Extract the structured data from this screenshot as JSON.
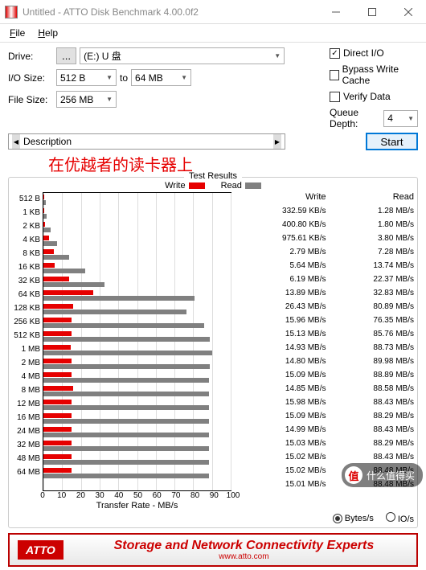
{
  "window": {
    "title": "Untitled - ATTO Disk Benchmark 4.00.0f2"
  },
  "menu": {
    "file": "File",
    "help": "Help"
  },
  "labels": {
    "drive": "Drive:",
    "iosize": "I/O Size:",
    "filesize": "File Size:",
    "to": "to",
    "directio": "Direct I/O",
    "bypass": "Bypass Write Cache",
    "verify": "Verify Data",
    "queue": "Queue Depth:",
    "desc": "Description",
    "start": "Start",
    "results": "Test Results",
    "write": "Write",
    "read": "Read",
    "xlabel": "Transfer Rate - MB/s",
    "bytes": "Bytes/s",
    "ios": "IO/s"
  },
  "values": {
    "drive_btn": "...",
    "drive": "(E:) U 盘",
    "iosize_from": "512 B",
    "iosize_to": "64 MB",
    "filesize": "256 MB",
    "queue": "4",
    "directio_checked": "✓"
  },
  "annotation": "在优越者的读卡器上",
  "footer": {
    "logo": "ATTO",
    "tagline": "Storage and Network Connectivity Experts",
    "url": "www.atto.com"
  },
  "watermark": "什么值得买",
  "chart_data": {
    "type": "bar",
    "title": "Test Results",
    "xlabel": "Transfer Rate - MB/s",
    "ylabel": "",
    "xlim": [
      0,
      100
    ],
    "x_ticks": [
      0,
      10,
      20,
      30,
      40,
      50,
      60,
      70,
      80,
      90,
      100
    ],
    "categories": [
      "512 B",
      "1 KB",
      "2 KB",
      "4 KB",
      "8 KB",
      "16 KB",
      "32 KB",
      "64 KB",
      "128 KB",
      "256 KB",
      "512 KB",
      "1 MB",
      "2 MB",
      "4 MB",
      "8 MB",
      "12 MB",
      "16 MB",
      "24 MB",
      "32 MB",
      "48 MB",
      "64 MB"
    ],
    "series": [
      {
        "name": "Write",
        "color": "#e60000",
        "values_display": [
          "332.59 KB/s",
          "400.80 KB/s",
          "975.61 KB/s",
          "2.79 MB/s",
          "5.64 MB/s",
          "6.19 MB/s",
          "13.89 MB/s",
          "26.43 MB/s",
          "15.96 MB/s",
          "15.13 MB/s",
          "14.93 MB/s",
          "14.80 MB/s",
          "15.09 MB/s",
          "14.85 MB/s",
          "15.98 MB/s",
          "15.09 MB/s",
          "14.99 MB/s",
          "15.03 MB/s",
          "15.02 MB/s",
          "15.02 MB/s",
          "15.01 MB/s"
        ],
        "values_mb": [
          0.33,
          0.4,
          0.98,
          2.79,
          5.64,
          6.19,
          13.89,
          26.43,
          15.96,
          15.13,
          14.93,
          14.8,
          15.09,
          14.85,
          15.98,
          15.09,
          14.99,
          15.03,
          15.02,
          15.02,
          15.01
        ]
      },
      {
        "name": "Read",
        "color": "#808080",
        "values_display": [
          "1.28 MB/s",
          "1.80 MB/s",
          "3.80 MB/s",
          "7.28 MB/s",
          "13.74 MB/s",
          "22.37 MB/s",
          "32.83 MB/s",
          "80.89 MB/s",
          "76.35 MB/s",
          "85.76 MB/s",
          "88.73 MB/s",
          "89.98 MB/s",
          "88.89 MB/s",
          "88.58 MB/s",
          "88.43 MB/s",
          "88.29 MB/s",
          "88.43 MB/s",
          "88.29 MB/s",
          "88.43 MB/s",
          "88.48 MB/s",
          "88.48 MB/s"
        ],
        "values_mb": [
          1.28,
          1.8,
          3.8,
          7.28,
          13.74,
          22.37,
          32.83,
          80.89,
          76.35,
          85.76,
          88.73,
          89.98,
          88.89,
          88.58,
          88.43,
          88.29,
          88.43,
          88.29,
          88.43,
          88.48,
          88.48
        ]
      }
    ]
  }
}
